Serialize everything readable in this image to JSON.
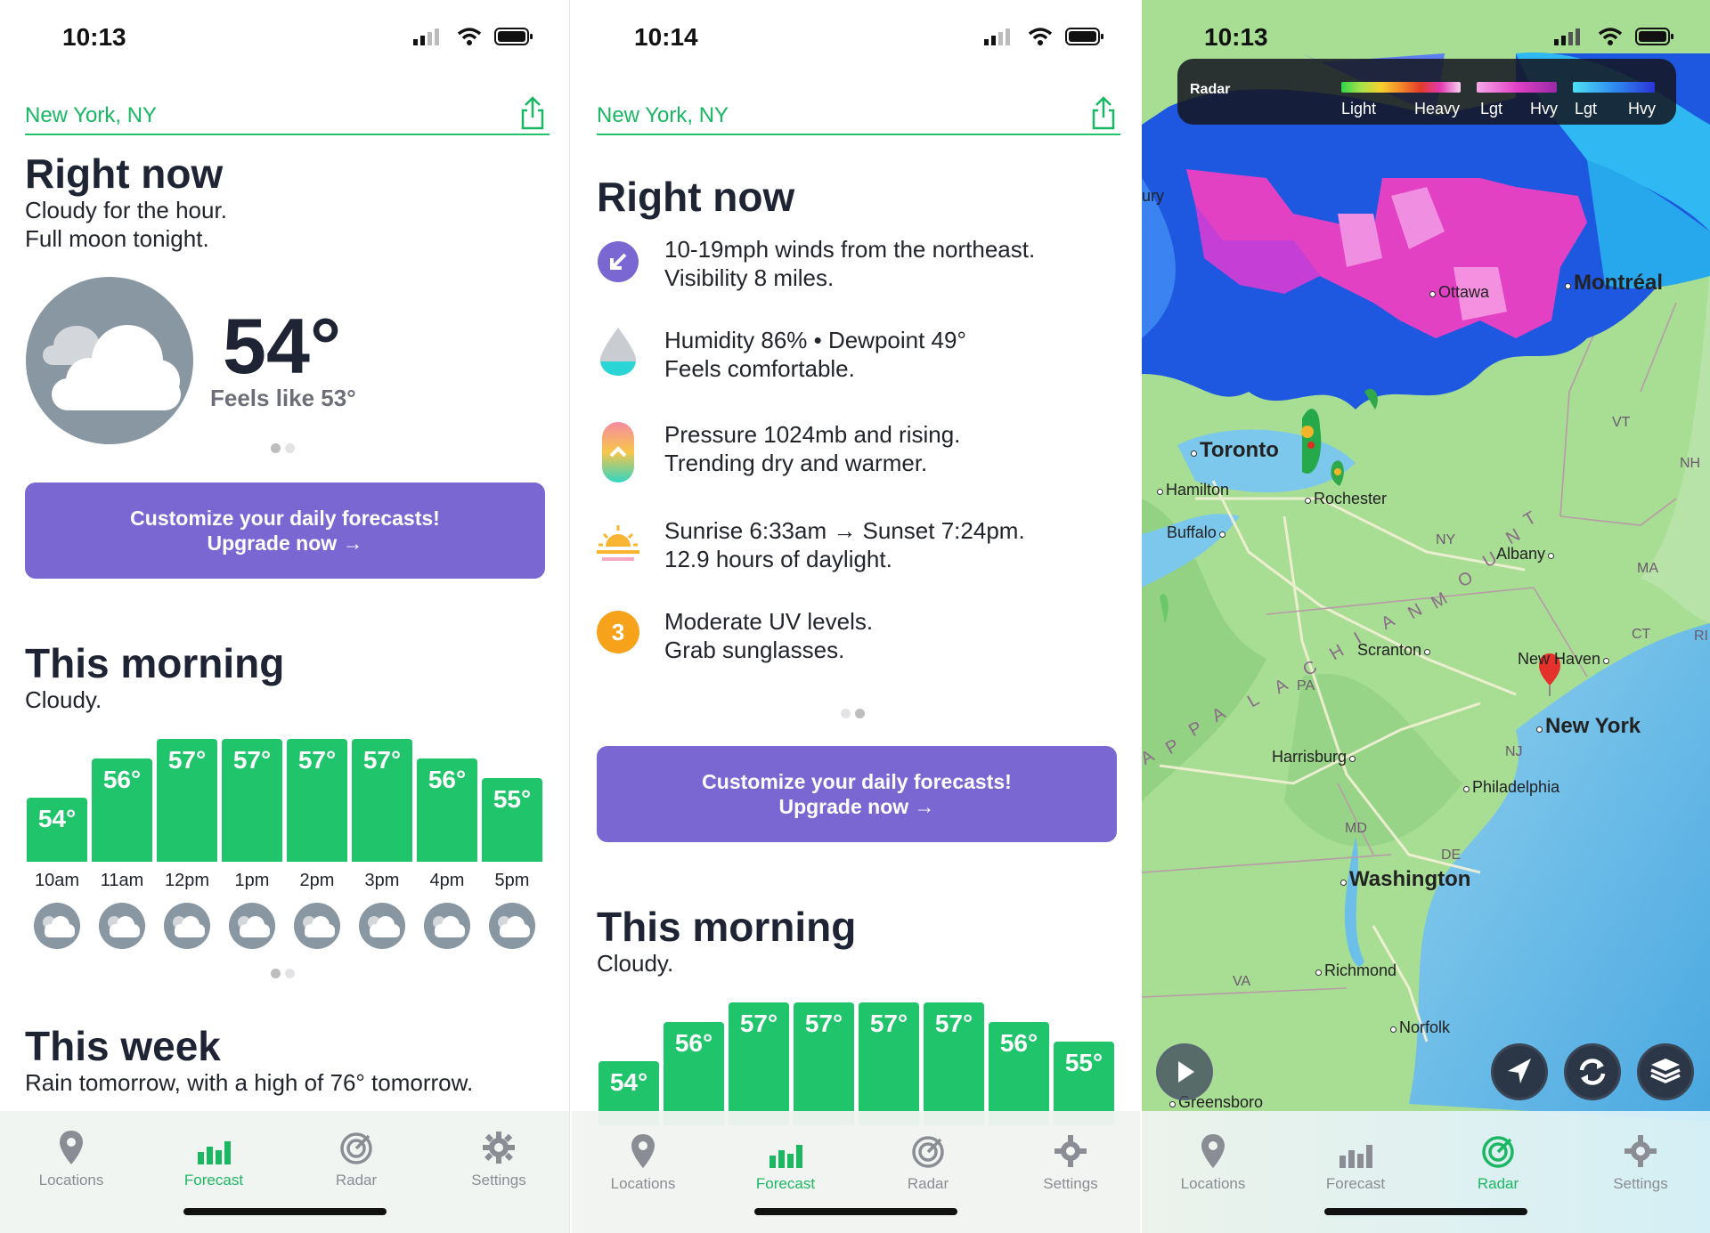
{
  "screen1": {
    "time": "10:13",
    "location": "New York, NY",
    "right_now_title": "Right now",
    "right_now_line1": "Cloudy for the hour.",
    "right_now_line2": "Full moon tonight.",
    "temp": "54°",
    "feels_like": "Feels like 53°",
    "upgrade_line1": "Customize your daily forecasts!",
    "upgrade_line2": "Upgrade now →",
    "morning_title": "This morning",
    "morning_sub": "Cloudy.",
    "week_title": "This week",
    "week_sub": "Rain tomorrow, with a high of 76° tomorrow."
  },
  "screen2": {
    "time": "10:14",
    "location": "New York, NY",
    "right_now_title": "Right now",
    "items": [
      {
        "line1": "10-19mph winds from the northeast.",
        "line2": "Visibility 8 miles."
      },
      {
        "line1": "Humidity 86% • Dewpoint 49°",
        "line2": "Feels comfortable."
      },
      {
        "line1": "Pressure 1024mb and rising.",
        "line2": "Trending dry and warmer."
      },
      {
        "line1": "Sunrise 6:33am → Sunset 7:24pm.",
        "line2": "12.9 hours of daylight."
      },
      {
        "line1": "Moderate UV levels.",
        "line2": "Grab sunglasses."
      }
    ],
    "uv_value": "3",
    "upgrade_line1": "Customize your daily forecasts!",
    "upgrade_line2": "Upgrade now →",
    "morning_title": "This morning",
    "morning_sub": "Cloudy."
  },
  "hourly": {
    "hours": [
      "10am",
      "11am",
      "12pm",
      "1pm",
      "2pm",
      "3pm",
      "4pm",
      "5pm"
    ],
    "temps": [
      54,
      56,
      57,
      57,
      57,
      57,
      56,
      55
    ],
    "labels": [
      "54°",
      "56°",
      "57°",
      "57°",
      "57°",
      "57°",
      "56°",
      "55°"
    ]
  },
  "screen3": {
    "time": "10:13",
    "legend": {
      "title": "Radar",
      "rain_light": "Light",
      "rain_heavy": "Heavy",
      "mix_light": "Lgt",
      "mix_heavy": "Hvy",
      "snow_light": "Lgt",
      "snow_heavy": "Hvy"
    },
    "cities": {
      "ottawa": "Ottawa",
      "montreal": "Montréal",
      "toronto": "Toronto",
      "hamilton": "Hamilton",
      "rochester": "Rochester",
      "buffalo": "Buffalo",
      "albany": "Albany",
      "scranton": "Scranton",
      "new_haven": "New Haven",
      "new_york": "New York",
      "harrisburg": "Harrisburg",
      "philadelphia": "Philadelphia",
      "washington": "Washington",
      "richmond": "Richmond",
      "norfolk": "Norfolk",
      "greensboro": "Greensboro",
      "edge_ury": "ury"
    },
    "states": {
      "vt": "VT",
      "nh": "NH",
      "ny": "NY",
      "ma": "MA",
      "ct": "CT",
      "ri": "RI",
      "pa": "PA",
      "nj": "NJ",
      "md": "MD",
      "de": "DE",
      "va": "VA"
    },
    "mountains": [
      "A",
      "P",
      "P",
      "A",
      "L",
      "A",
      "C",
      "H",
      "I",
      "A",
      "N",
      "M",
      "O",
      "U",
      "N",
      "T"
    ]
  },
  "tabs": {
    "locations": "Locations",
    "forecast": "Forecast",
    "radar": "Radar",
    "settings": "Settings"
  },
  "colors": {
    "accent_green": "#1fc46b",
    "upgrade_purple": "#7b67d2",
    "text_dark": "#1f2434",
    "cloud_gray": "#8897a2"
  }
}
